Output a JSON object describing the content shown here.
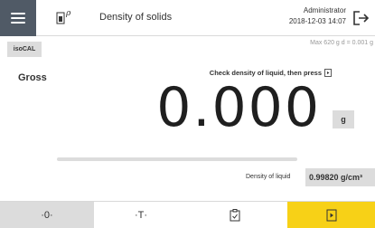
{
  "header": {
    "title": "Density of solids",
    "app_icon_letter": "ρ",
    "user_name": "Administrator",
    "datetime": "2018-12-03 14:07"
  },
  "status": {
    "isocal_label": "isoCAL",
    "max_info": "Max 620 g  d = 0.001 g"
  },
  "weighing": {
    "mode_label": "Gross",
    "instruction": "Check density of liquid, then press",
    "value": "0.000",
    "unit": "g",
    "capacity_used_fraction": 0
  },
  "density": {
    "label": "Density of liquid",
    "value": "0.99820 g/cm³"
  },
  "toolbar": {
    "zero_label": "·0·",
    "tare_label": "·T·"
  },
  "colors": {
    "menu_bg": "#505a66",
    "accent_yellow": "#f7d117",
    "button_gray": "#dcdcdc"
  }
}
